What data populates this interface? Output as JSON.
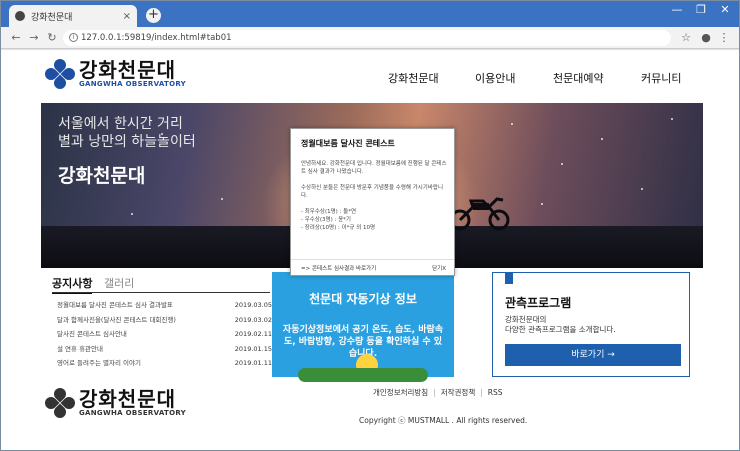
{
  "browser": {
    "tab_title": "강화천문대",
    "tab_close": "×",
    "new_tab": "+",
    "url": "127.0.0.1:59819/index.html#tab01",
    "nav_icons": [
      "back-icon",
      "forward-icon",
      "reload-icon"
    ],
    "window_controls": [
      "—",
      "❐",
      "✕"
    ],
    "toolbar_icons": [
      "☆",
      "●",
      "⋮"
    ]
  },
  "site": {
    "logo_ko": "강화천문대",
    "logo_en": "GANGWHA OBSERVATORY",
    "logo_color": "#1e4fa3",
    "nav": [
      "강화천문대",
      "이용안내",
      "천문대예약",
      "커뮤니티"
    ]
  },
  "hero": {
    "line1": "서울에서 한시간 거리",
    "line2": "별과 낭만의 하늘놀이터",
    "title": "강화천문대"
  },
  "notice": {
    "tabs": [
      "공지사항",
      "갤러리"
    ],
    "items": [
      {
        "title": "정월대보름 달사진 콘테스트 심사 결과발표",
        "date": "2019.03.05"
      },
      {
        "title": "달과 함께사진을(달사진 콘테스트 대회진행)",
        "date": "2019.03.02"
      },
      {
        "title": "달사진 콘테스트 심사안내",
        "date": "2019.02.11"
      },
      {
        "title": "설 연휴 휴관안내",
        "date": "2019.01.15"
      },
      {
        "title": "영어로 들려주는 별자리 이야기",
        "date": "2019.01.11"
      }
    ]
  },
  "weather": {
    "title": "천문대 자동기상 정보",
    "desc": "자동기상정보에서 공기 온도, 습도, 바람속도, 바람방향, 강수량 등을 확인하실 수 있습니다.",
    "bg_color": "#2aa0e0"
  },
  "program": {
    "title": "관측프로그램",
    "desc_line1": "강화천문대의",
    "desc_line2": "다양한 관측프로그램을 소개합니다.",
    "button": "바로가기 →",
    "accent": "#1e5fae"
  },
  "footer": {
    "links": [
      "개인정보처리방침",
      "저작권정책",
      "RSS"
    ],
    "copyright": "Copyright ⓒ MUSTMALL . All rights reserved."
  },
  "popup": {
    "title": "정월대보름 달사진 콘테스트",
    "p1": "안녕하세요. 강화천문대 입니다. 정월대보름에 진행된 달 콘테스트 심사 결과가 나왔습니다.",
    "p2": "수상하신 분들은 천문대 방문후 기념품을 수령해 가시기바랍니다.",
    "p3_1": "- 최우수상(1명) : 돌*연",
    "p3_2": "- 우수상(3명) : 윤*기",
    "p3_3": "- 장려상(10명) : 이*규 외 10명",
    "link": "=> 콘테스트 심사결과 바로가기",
    "close": "닫기X"
  }
}
